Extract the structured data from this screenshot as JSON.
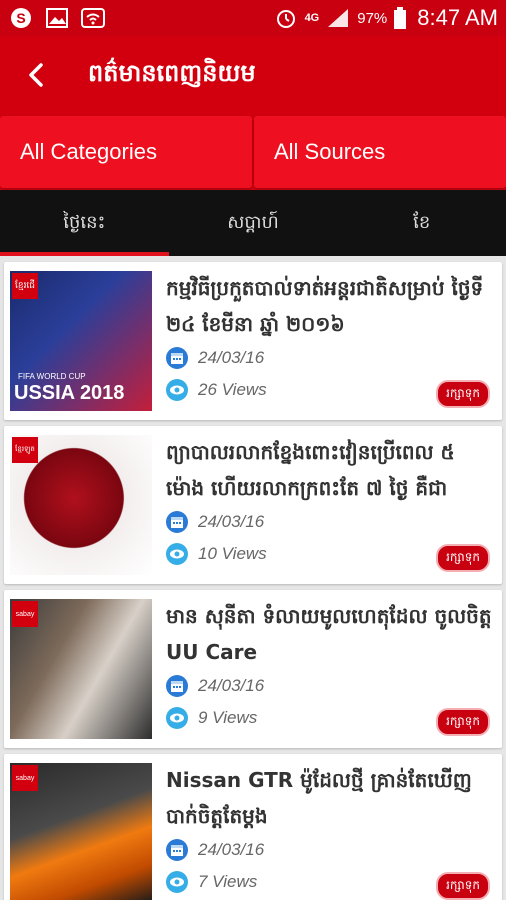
{
  "status_bar": {
    "battery": "97%",
    "time": "8:47 AM",
    "network": "4G"
  },
  "app_bar": {
    "title": "ពត៌មានពេញនិយម"
  },
  "filters": {
    "categories": "All Categories",
    "sources": "All Sources"
  },
  "tabs": [
    {
      "label": "ថ្ងៃនេះ",
      "active": true
    },
    {
      "label": "សប្តាហ៍",
      "active": false
    },
    {
      "label": "ខែ",
      "active": false
    }
  ],
  "articles": [
    {
      "title": "កម្មវិធីប្រកួតបាល់ទាត់អន្តរជាតិសម្រាប់ ថ្ងៃទី ២៤ ខែមីនា ឆ្នាំ ២០១៦",
      "date": "24/03/16",
      "views": "26 Views",
      "save": "រក្សាទុក",
      "badge": "ខ្មែរជើ",
      "thumb_caption": "USSIA 2018",
      "thumb_sub": "FIFA WORLD CUP"
    },
    {
      "title": "ព្យាបាលរលាកខ្នែងពោះវៀនប្រើពេល ៥ ម៉ោង ហើយរលាកក្រពះតែ ៧ ថ្ងៃ គឺជា",
      "date": "24/03/16",
      "views": "10 Views",
      "save": "រក្សាទុក",
      "badge": "ខ្មែរឡូត"
    },
    {
      "title": "មាន សុនីតា ទំលាយមូលហេតុដែល ចូលចិត្ត UU Care",
      "date": "24/03/16",
      "views": "9 Views",
      "save": "រក្សាទុក",
      "badge": "sabay"
    },
    {
      "title": "Nissan GTR ម៉ូដែលថ្មី គ្រាន់តែឃើញ បាក់ចិត្តតែម្តង",
      "date": "24/03/16",
      "views": "7 Views",
      "save": "រក្សាទុក",
      "badge": "sabay"
    }
  ]
}
